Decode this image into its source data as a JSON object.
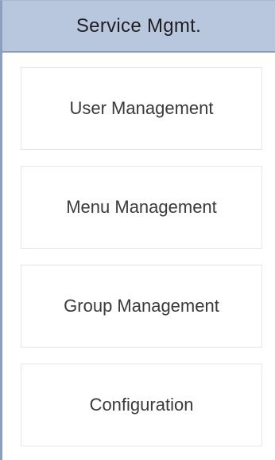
{
  "header": {
    "title": "Service Mgmt."
  },
  "menu": {
    "items": [
      {
        "label": "User Management"
      },
      {
        "label": "Menu Management"
      },
      {
        "label": "Group Management"
      },
      {
        "label": "Configuration"
      }
    ]
  }
}
